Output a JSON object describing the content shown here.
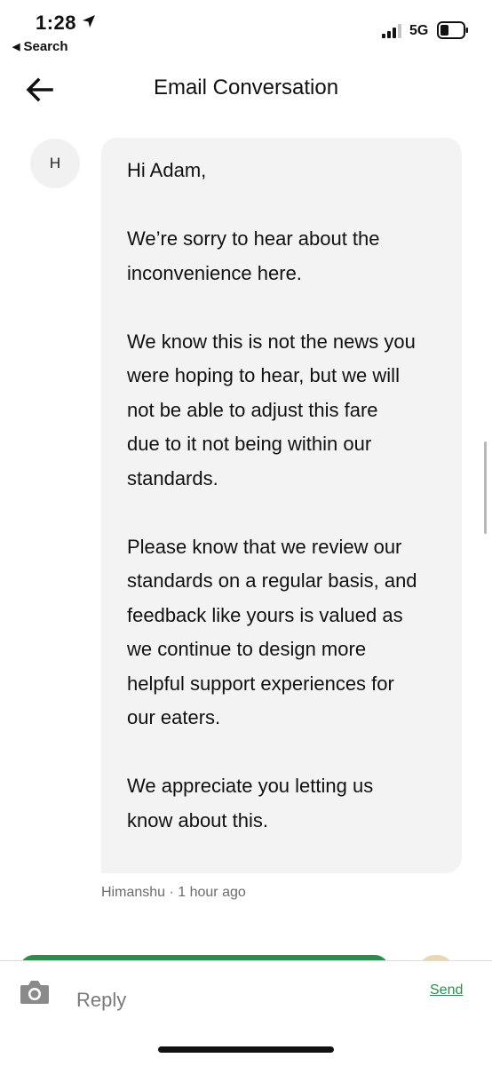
{
  "status_bar": {
    "time": "1:28",
    "back_app": "Search",
    "network": "5G"
  },
  "header": {
    "title": "Email Conversation"
  },
  "message": {
    "avatar_initial": "H",
    "paragraphs": [
      [
        "Hi Adam,"
      ],
      [
        "We’re sorry to hear about the",
        "inconvenience here."
      ],
      [
        "We know this is not the news you",
        "were hoping to hear, but we will",
        "not be able to adjust this fare",
        "due to it not being within our",
        "standards."
      ],
      [
        "Please know that we review our",
        "standards on a regular basis, and",
        "feedback like yours is valued as",
        "we continue to design more",
        "helpful support experiences for",
        "our eaters."
      ],
      [
        "We appreciate you letting us",
        "know about this."
      ]
    ],
    "sender": "Himanshu",
    "time_ago": "1 hour ago"
  },
  "composer": {
    "placeholder": "Reply",
    "value": "",
    "send_label": "Send"
  },
  "colors": {
    "accent": "#2e8b4f",
    "bubble": "#f3f3f3"
  }
}
